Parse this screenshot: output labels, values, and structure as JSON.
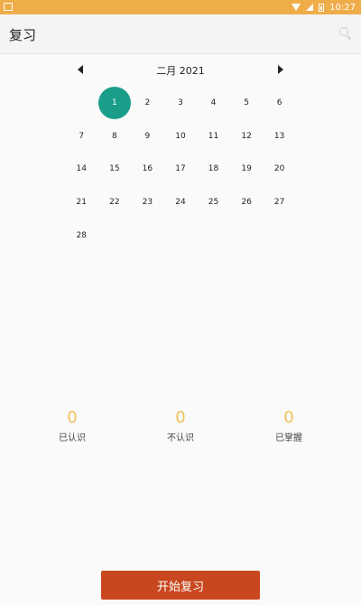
{
  "status_bar": {
    "time": "10:27"
  },
  "app_bar": {
    "title": "复习"
  },
  "calendar": {
    "month_label": "二月 2021",
    "leading_blanks": 1,
    "selected_day": "1",
    "days": [
      "1",
      "2",
      "3",
      "4",
      "5",
      "6",
      "7",
      "8",
      "9",
      "10",
      "11",
      "12",
      "13",
      "14",
      "15",
      "16",
      "17",
      "18",
      "19",
      "20",
      "21",
      "22",
      "23",
      "24",
      "25",
      "26",
      "27",
      "28"
    ]
  },
  "stats": [
    {
      "value": "0",
      "label": "已认识"
    },
    {
      "value": "0",
      "label": "不认识"
    },
    {
      "value": "0",
      "label": "已掌握"
    }
  ],
  "start_button": {
    "label": "开始复习"
  },
  "colors": {
    "status_bar": "#efad4a",
    "selected_day": "#1a9e8a",
    "stat_value": "#f2c15a",
    "button": "#c9471f"
  }
}
